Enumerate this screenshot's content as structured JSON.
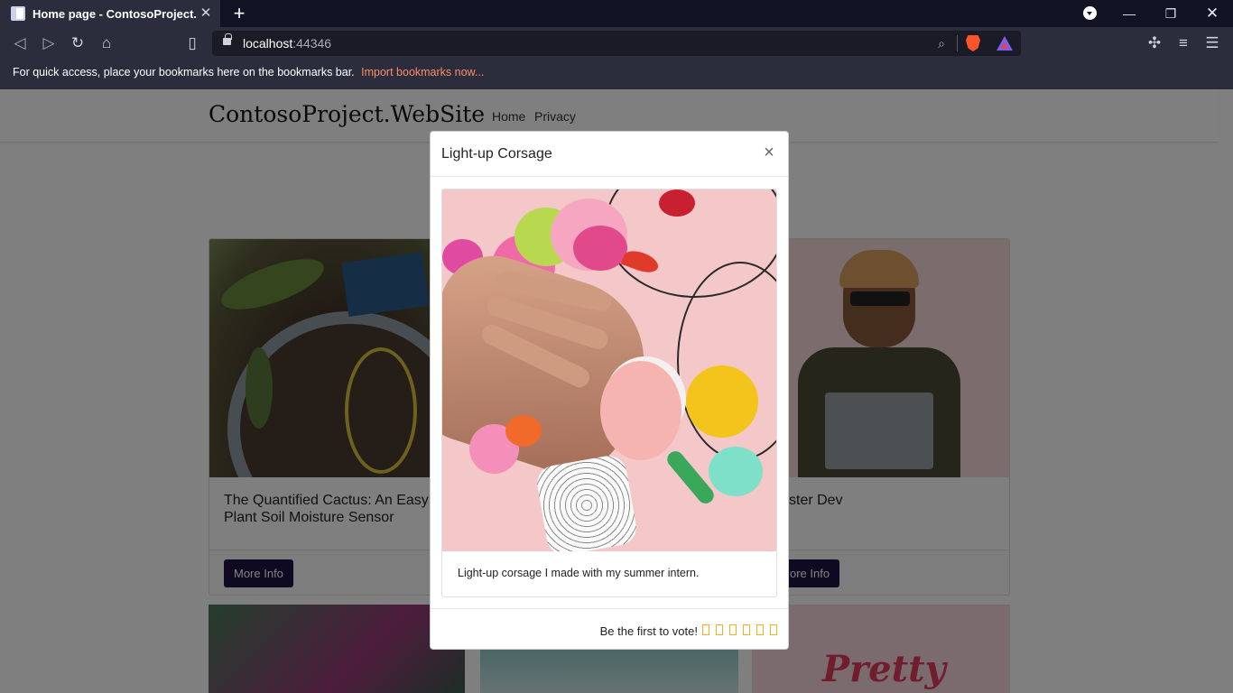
{
  "browser": {
    "tab_title": "Home page - ContosoProject.WebSite",
    "url_host": "localhost",
    "url_port": ":44346",
    "bookmarks_prompt": "For quick access, place your bookmarks here on the bookmarks bar.",
    "bookmarks_import": "Import bookmarks now..."
  },
  "site": {
    "brand": "ContosoProject.WebSite",
    "nav": [
      "Home",
      "Privacy"
    ]
  },
  "cards": [
    {
      "title": "The Quantified Cactus: An Easy Plant Soil Moisture Sensor",
      "button": "More Info"
    },
    {
      "title": "ster Dev",
      "button": "ore Info"
    }
  ],
  "row2_text": "Pretty",
  "modal": {
    "title": "Light-up Corsage",
    "close": "×",
    "description": "Light-up corsage I made with my summer intern.",
    "vote_prompt": "Be the first to vote!",
    "star_count": 6
  },
  "colors": {
    "chrome_dark": "#111324",
    "chrome": "#2b2d3c",
    "button": "#1f1545",
    "link_accent": "#ff8a6c",
    "star": "#f0b020"
  }
}
